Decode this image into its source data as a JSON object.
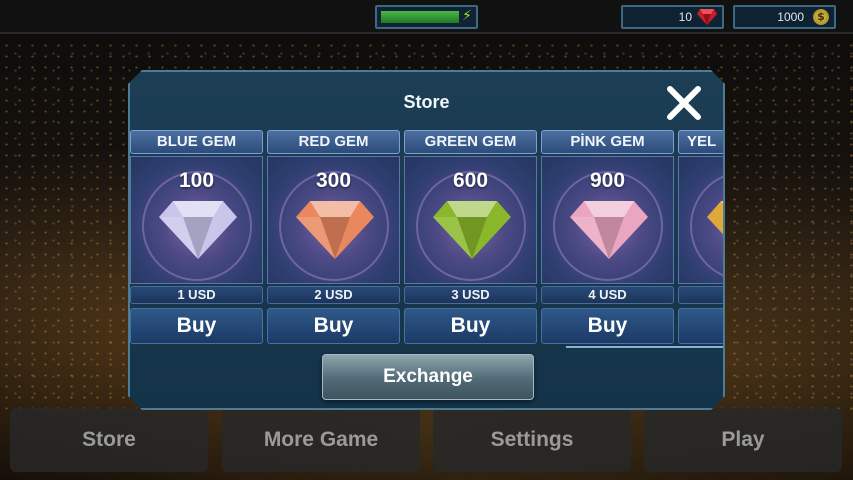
{
  "topbar": {
    "energy_level": 0.82,
    "gems_count": "10",
    "coins_count": "1000",
    "coin_symbol": "$"
  },
  "store": {
    "title": "Store",
    "exchange_label": "Exchange",
    "items": [
      {
        "name": "BLUE GEM",
        "quantity": "100",
        "price": "1 USD",
        "buy_label": "Buy",
        "color": "#c9c6ec"
      },
      {
        "name": "RED GEM",
        "quantity": "300",
        "price": "2 USD",
        "buy_label": "Buy",
        "color": "#e9885e"
      },
      {
        "name": "GREEN GEM",
        "quantity": "600",
        "price": "3 USD",
        "buy_label": "Buy",
        "color": "#8ab82a"
      },
      {
        "name": "PİNK GEM",
        "quantity": "900",
        "price": "4 USD",
        "buy_label": "Buy",
        "color": "#eaa6c0"
      },
      {
        "name": "YEL",
        "quantity": "",
        "price": "",
        "buy_label": "",
        "color": "#e0a838"
      }
    ]
  },
  "menu": {
    "store_label": "Store",
    "more_game_label": "More Game",
    "settings_label": "Settings",
    "play_label": "Play"
  }
}
